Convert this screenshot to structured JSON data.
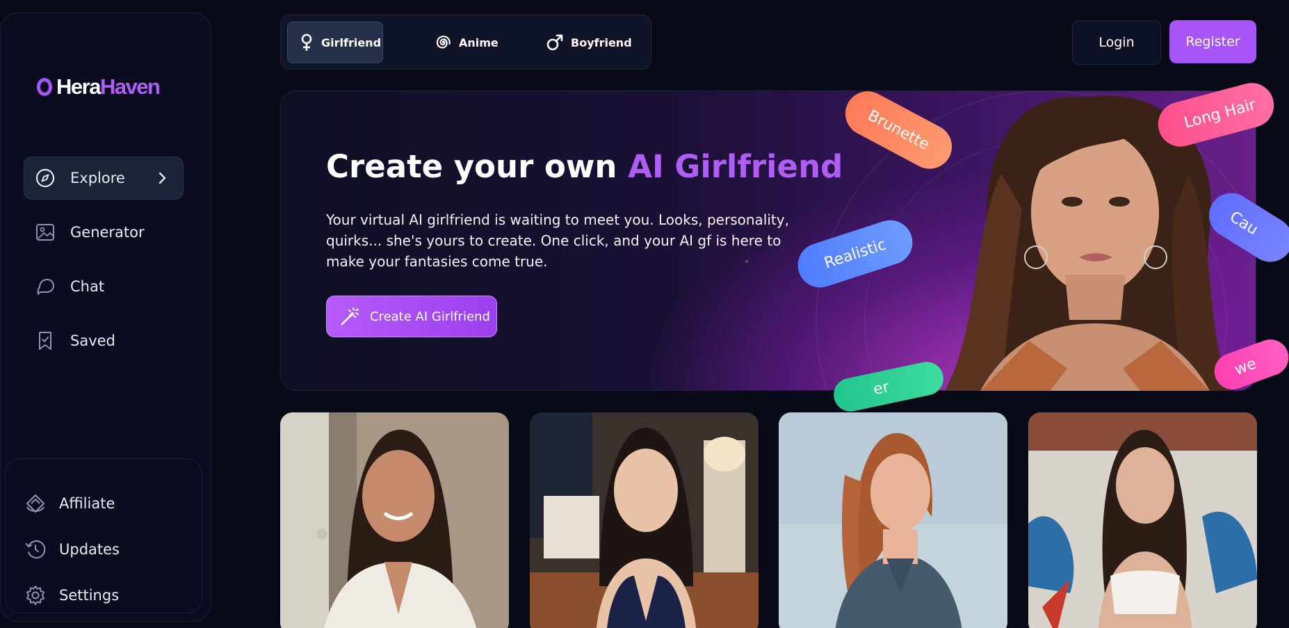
{
  "brand": {
    "name_part1": "Hera",
    "name_part2": "Haven"
  },
  "sidebar": {
    "items": [
      {
        "label": "Explore",
        "icon": "compass-icon",
        "active": true
      },
      {
        "label": "Generator",
        "icon": "image-generator-icon"
      },
      {
        "label": "Chat",
        "icon": "chat-bubble-icon"
      },
      {
        "label": "Saved",
        "icon": "bookmark-check-icon"
      }
    ],
    "bottom_items": [
      {
        "label": "Affiliate",
        "icon": "affiliate-icon"
      },
      {
        "label": "Updates",
        "icon": "history-icon"
      },
      {
        "label": "Settings",
        "icon": "gear-icon"
      }
    ]
  },
  "tabs": [
    {
      "label": "Girlfriend",
      "icon": "female-symbol-icon",
      "active": true
    },
    {
      "label": "Anime",
      "icon": "spiral-icon"
    },
    {
      "label": "Boyfriend",
      "icon": "male-symbol-icon"
    }
  ],
  "header": {
    "login_label": "Login",
    "register_label": "Register"
  },
  "hero": {
    "title_prefix": "Create your own ",
    "title_accent": "AI Girlfriend",
    "description": "Your virtual AI girlfriend is waiting to meet you. Looks, personality, quirks... she's yours to create. One click, and your AI gf is here to make your fantasies come true.",
    "cta_label": "Create AI Girlfriend",
    "tags": [
      "Brunette",
      "Long Hair",
      "Realistic",
      "Cau",
      "we",
      "er"
    ]
  },
  "colors": {
    "accent": "#a855f7",
    "background": "#080a18",
    "sidebar": "#0a0d1f"
  }
}
